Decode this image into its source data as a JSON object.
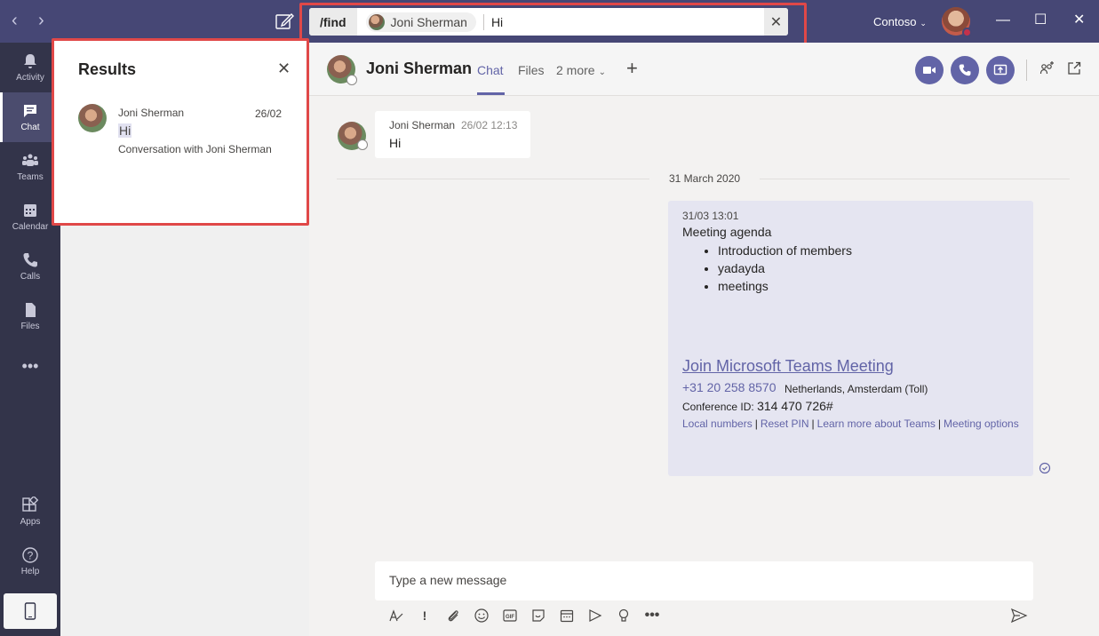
{
  "titlebar": {
    "back_icon": "chevron-left-icon",
    "forward_icon": "chevron-right-icon",
    "compose_icon": "compose-icon",
    "org_name": "Contoso",
    "minimize_icon": "minimize-icon",
    "maximize_icon": "maximize-icon",
    "close_icon": "close-icon"
  },
  "search": {
    "command": "/find",
    "chip_name": "Joni Sherman",
    "query": "Hi",
    "clear_icon": "close-icon"
  },
  "rail": {
    "items": [
      {
        "label": "Activity",
        "icon": "bell-icon"
      },
      {
        "label": "Chat",
        "icon": "chat-icon",
        "active": true
      },
      {
        "label": "Teams",
        "icon": "teams-icon"
      },
      {
        "label": "Calendar",
        "icon": "calendar-icon"
      },
      {
        "label": "Calls",
        "icon": "phone-icon"
      },
      {
        "label": "Files",
        "icon": "file-icon"
      },
      {
        "label": "",
        "icon": "more-icon"
      },
      {
        "label": "Apps",
        "icon": "apps-icon"
      },
      {
        "label": "Help",
        "icon": "help-icon"
      }
    ]
  },
  "results": {
    "title": "Results",
    "close_icon": "close-icon",
    "items": [
      {
        "name": "Joni Sherman",
        "date": "26/02",
        "message": "Hi",
        "context": "Conversation with Joni Sherman"
      }
    ]
  },
  "header": {
    "name": "Joni Sherman",
    "tabs": [
      {
        "label": "Chat",
        "active": true
      },
      {
        "label": "Files",
        "active": false
      },
      {
        "label": "2 more",
        "active": false
      }
    ],
    "accent_color": "#6264a7"
  },
  "messages": {
    "first": {
      "name": "Joni Sherman",
      "time": "26/02 12:13",
      "text": "Hi"
    },
    "date_divider": "31 March 2020",
    "second": {
      "time": "31/03 13:01",
      "title": "Meeting agenda",
      "bullets": [
        "Introduction of members",
        "yadayda",
        "meetings"
      ],
      "join_link": "Join Microsoft Teams Meeting",
      "phone": "+31 20 258 8570",
      "location": "Netherlands, Amsterdam (Toll)",
      "conf_label": "Conference ID:",
      "conf_id": "314 470 726#",
      "links": [
        "Local numbers",
        "Reset PIN",
        "Learn more about Teams",
        "Meeting options"
      ]
    }
  },
  "compose": {
    "placeholder": "Type a new message"
  }
}
